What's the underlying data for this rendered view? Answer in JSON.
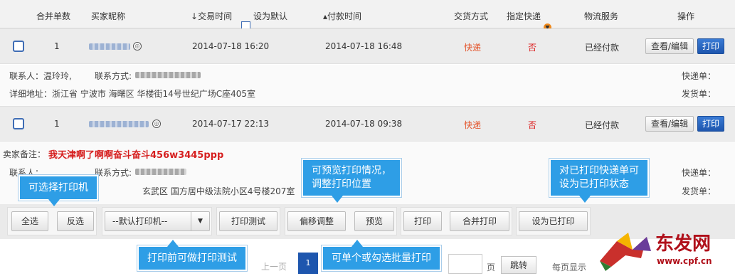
{
  "header": {
    "merge_count": "合并单数",
    "buyer_nick": "买家昵称",
    "trade_time": "交易时间",
    "set_default": "设为默认",
    "pay_time": "付款时间",
    "delivery_method": "交货方式",
    "designated_express": "指定快递",
    "logistics": "物流服务",
    "operation": "操作"
  },
  "orders": [
    {
      "merge_count": "1",
      "trade_time": "2014-07-18 16:20",
      "pay_time": "2014-07-18 16:48",
      "delivery": "快递",
      "designated": "否",
      "logistics": "已经付款",
      "view_btn": "查看/编辑",
      "print_btn": "打印",
      "contact_label": "联系人：温玲玲,",
      "contact_method_label": "联系方式:",
      "address": "详细地址：浙江省 宁波市 海曙区 华楼街14号世纪广场C座405室",
      "express_no_label": "快递单：",
      "ship_no_label": "发货单："
    },
    {
      "merge_count": "1",
      "trade_time": "2014-07-17 22:13",
      "pay_time": "2014-07-18 09:38",
      "delivery": "快递",
      "designated": "否",
      "logistics": "已经付款",
      "view_btn": "查看/编辑",
      "print_btn": "打印",
      "seller_note_label": "卖家备注：",
      "seller_note": "我天津啊了啊啊奋斗奋斗456w3445ppp",
      "contact_label": "联系人：",
      "contact_method_label": "联系方式:",
      "address_tail": "玄武区 国方居中级法院小区4号楼207室",
      "express_no_label": "快递单：",
      "ship_no_label": "发货单："
    }
  ],
  "toolbar": {
    "select_all": "全选",
    "invert": "反选",
    "printer_select": "--默认打印机--",
    "print_test": "打印测试",
    "offset_adjust": "偏移调整",
    "preview": "预览",
    "print": "打印",
    "merge_print": "合并打印",
    "set_printed": "设为已打印"
  },
  "callouts": {
    "choose_printer": "可选择打印机",
    "preview_adjust_line1": "可预览打印情况，",
    "preview_adjust_line2": "调整打印位置",
    "set_printed_line1": "对已打印快递单可",
    "set_printed_line2": "设为已打印状态",
    "test_before": "打印前可做打印测试",
    "batch_print": "可单个或勾选批量打印"
  },
  "pager": {
    "prev": "上一页",
    "current_page": "1",
    "page_unit": "页",
    "jump": "跳转",
    "per_page": "每页显示"
  },
  "watermark": {
    "brand": "东发网",
    "url": "www.cpf.cn"
  },
  "colors": {
    "accent_blue": "#2e9ee6",
    "button_blue": "#1e56ae",
    "highlight_red": "#e4572e"
  }
}
